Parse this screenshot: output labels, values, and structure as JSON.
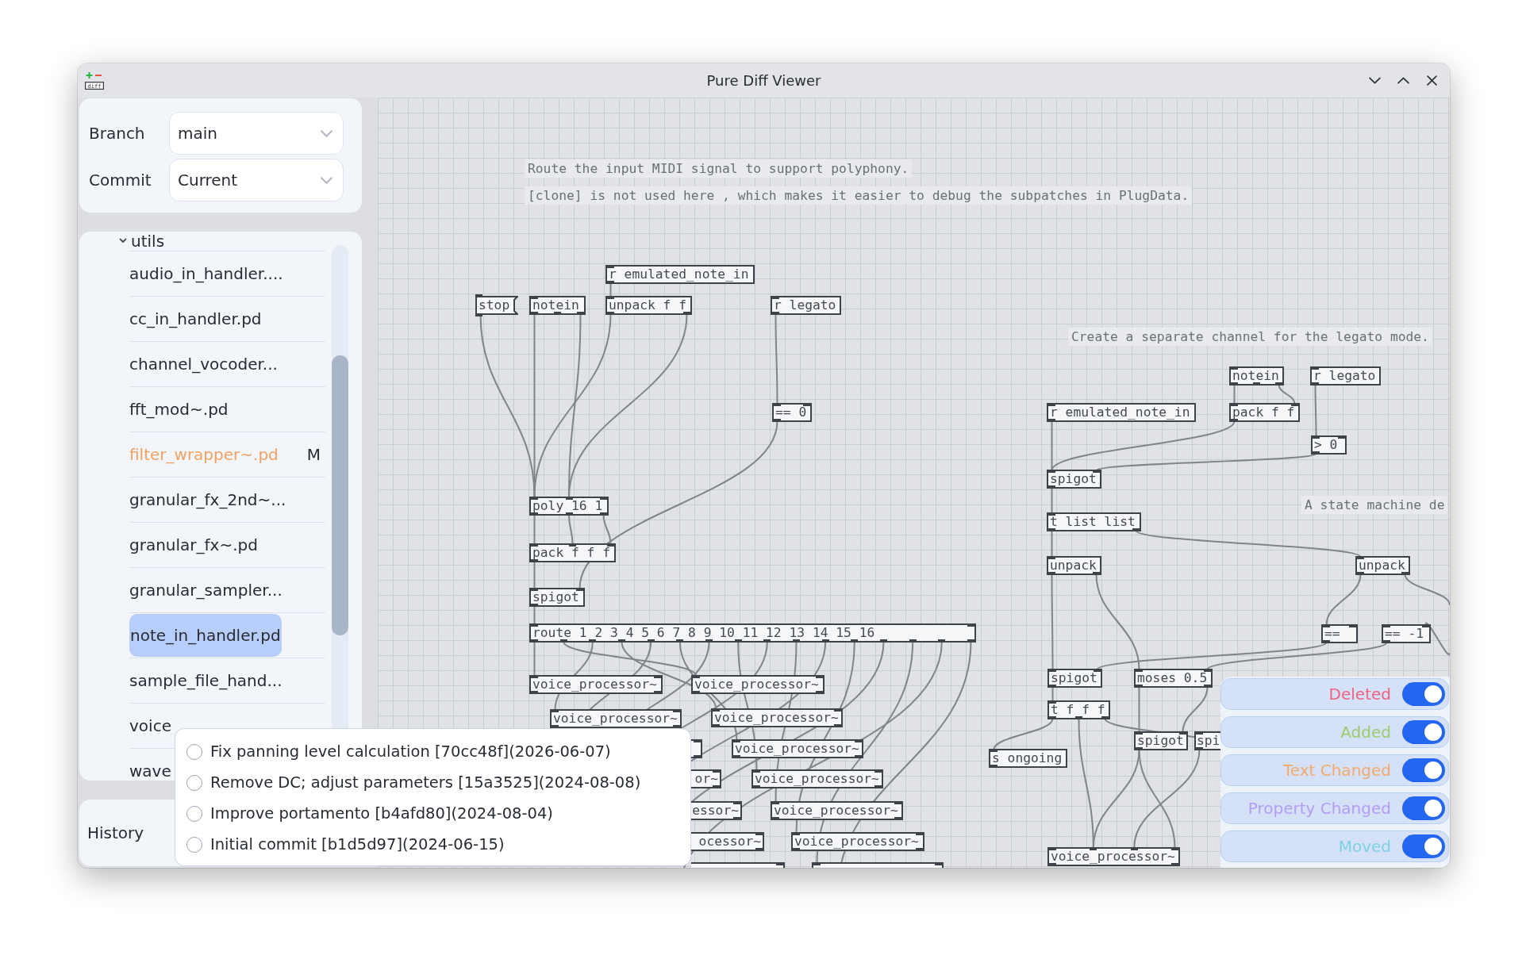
{
  "window": {
    "title": "Pure Diff Viewer",
    "logo_caption": "diff"
  },
  "selectors": [
    {
      "label": "Branch",
      "value": "main"
    },
    {
      "label": "Commit",
      "value": "Current"
    }
  ],
  "file_tree": {
    "folder": "utils",
    "expanded": true,
    "files": [
      {
        "name": "audio_in_handler....",
        "selected": false,
        "modified": false
      },
      {
        "name": "cc_in_handler.pd",
        "selected": false,
        "modified": false
      },
      {
        "name": "channel_vocoder...",
        "selected": false,
        "modified": false
      },
      {
        "name": "fft_mod~.pd",
        "selected": false,
        "modified": false
      },
      {
        "name": "filter_wrapper~.pd",
        "selected": false,
        "modified": true,
        "badge": "M"
      },
      {
        "name": "granular_fx_2nd~...",
        "selected": false,
        "modified": false
      },
      {
        "name": "granular_fx~.pd",
        "selected": false,
        "modified": false
      },
      {
        "name": "granular_sampler...",
        "selected": false,
        "modified": false
      },
      {
        "name": "note_in_handler.pd",
        "selected": true,
        "modified": false
      },
      {
        "name": "sample_file_hand...",
        "selected": false,
        "modified": false
      },
      {
        "name": "voice",
        "selected": false,
        "modified": false
      },
      {
        "name": "wave",
        "selected": false,
        "modified": false
      }
    ]
  },
  "history": {
    "label": "History",
    "commits": [
      {
        "label": "Fix panning level calculation [70cc48f](2026-06-07)",
        "selected": false
      },
      {
        "label": "Remove DC; adjust parameters [15a3525](2024-08-08)",
        "selected": false
      },
      {
        "label": "Improve portamento [b4afd80](2024-08-04)",
        "selected": false
      },
      {
        "label": "Initial commit [b1d5d97](2024-06-15)",
        "selected": false
      }
    ]
  },
  "canvas": {
    "comments": [
      "Route the input MIDI signal to support polyphony.",
      "[clone] is not used here , which makes it easier to debug the subpatches in PlugData.",
      "Create a separate channel for the legato mode.",
      "A state machine de"
    ],
    "objects": [
      {
        "kind": "message",
        "text": "stop"
      },
      {
        "kind": "object",
        "text": "notein"
      },
      {
        "kind": "object",
        "text": "r emulated_note_in"
      },
      {
        "kind": "object",
        "text": "unpack f f"
      },
      {
        "kind": "object",
        "text": "r legato"
      },
      {
        "kind": "object",
        "text": "== 0"
      },
      {
        "kind": "object",
        "text": "poly 16 1"
      },
      {
        "kind": "object",
        "text": "pack f f f"
      },
      {
        "kind": "object",
        "text": "spigot"
      },
      {
        "kind": "object",
        "text": "route 1 2 3 4 5 6 7 8 9 10 11 12 13 14 15 16"
      },
      {
        "kind": "object",
        "text": "voice_processor~"
      },
      {
        "kind": "object",
        "text": "voice_processor~"
      },
      {
        "kind": "object",
        "text": "voice_processor~"
      },
      {
        "kind": "object",
        "text": "voice_processor~"
      },
      {
        "kind": "object"
      },
      {
        "kind": "object",
        "text": "voice_processor~"
      },
      {
        "kind": "object",
        "text": "or~"
      },
      {
        "kind": "object",
        "text": "voice_processor~"
      },
      {
        "kind": "object",
        "text": "essor~"
      },
      {
        "kind": "object",
        "text": "voice_processor~"
      },
      {
        "kind": "object",
        "text": "ocessor~"
      },
      {
        "kind": "object",
        "text": "voice_processor~"
      },
      {
        "kind": "object"
      },
      {
        "kind": "object"
      },
      {
        "kind": "object",
        "text": "notein"
      },
      {
        "kind": "object",
        "text": "r legato"
      },
      {
        "kind": "object",
        "text": "r emulated_note_in"
      },
      {
        "kind": "object",
        "text": "pack f f"
      },
      {
        "kind": "object",
        "text": "> 0"
      },
      {
        "kind": "object",
        "text": "spigot"
      },
      {
        "kind": "object",
        "text": "t list list"
      },
      {
        "kind": "object",
        "text": "unpack"
      },
      {
        "kind": "object",
        "text": "unpack"
      },
      {
        "kind": "object",
        "text": "=="
      },
      {
        "kind": "object",
        "text": "== -1"
      },
      {
        "kind": "object",
        "text": "spigot"
      },
      {
        "kind": "object",
        "text": "moses 0.5"
      },
      {
        "kind": "object",
        "text": "t f f f"
      },
      {
        "kind": "object",
        "text": "s ongoing"
      },
      {
        "kind": "object",
        "text": "spigot"
      },
      {
        "kind": "object",
        "text": "spi"
      },
      {
        "kind": "object",
        "text": "voice_processor~"
      }
    ]
  },
  "filters": [
    {
      "label": "Deleted",
      "color": "#f2617e",
      "on": true
    },
    {
      "label": "Added",
      "color": "#9ccb6e",
      "on": true
    },
    {
      "label": "Text Changed",
      "color": "#f4a96c",
      "on": true
    },
    {
      "label": "Property Changed",
      "color": "#b59df2",
      "on": true
    },
    {
      "label": "Moved",
      "color": "#7fd0e2",
      "on": true
    }
  ]
}
